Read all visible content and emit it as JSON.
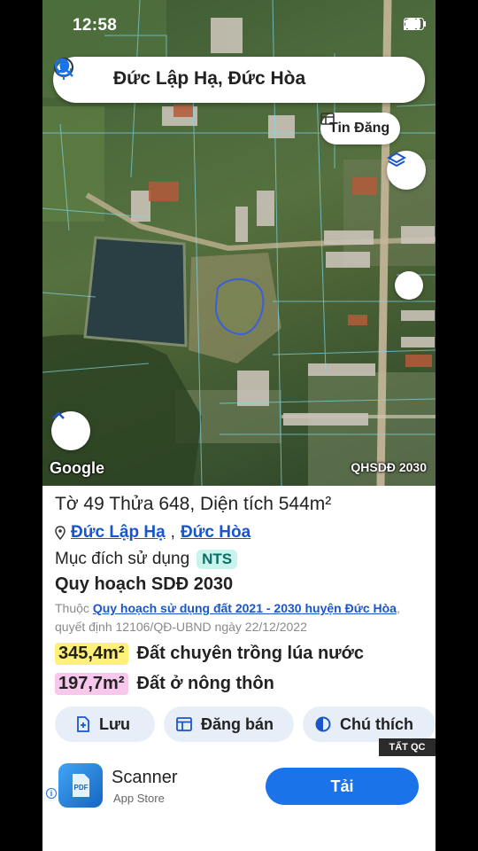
{
  "status": {
    "time": "12:58"
  },
  "search": {
    "query": "Đức Lập Hạ, Đức Hòa"
  },
  "map": {
    "listing_chip": "Tin Đăng",
    "attribution": "Google",
    "layer_badge": "QHSDĐ 2030"
  },
  "parcel": {
    "title": "Tờ 49 Thửa 648, Diện tích 544m²",
    "commune": "Đức Lập Hạ",
    "district": "Đức Hòa",
    "separator": ",",
    "purpose_label": "Mục đích sử dụng",
    "purpose_code": "NTS",
    "plan_title": "Quy hoạch SDĐ 2030",
    "plan_prefix": "Thuộc",
    "plan_link": "Quy hoạch sử dụng đất 2021 - 2030 huyện Đức Hòa",
    "plan_suffix": ", quyết định 12106/QĐ-UBND ngày 22/12/2022",
    "areas": [
      {
        "value": "345,4m²",
        "label": "Đất chuyên trồng lúa nước",
        "color": "#fff176"
      },
      {
        "value": "197,7m²",
        "label": "Đất ở nông thôn",
        "color": "#f8c8ec"
      }
    ]
  },
  "actions": {
    "save": "Lưu",
    "sell": "Đăng bán",
    "legend": "Chú thích"
  },
  "ad": {
    "tag": "TẤT QC",
    "app_name": "Scanner",
    "store": "App Store",
    "cta": "Tải",
    "icon_text": "PDF"
  },
  "colors": {
    "accent": "#1a73e8",
    "link": "#1a56c9",
    "parcel_outline": "#3a5fd8"
  }
}
